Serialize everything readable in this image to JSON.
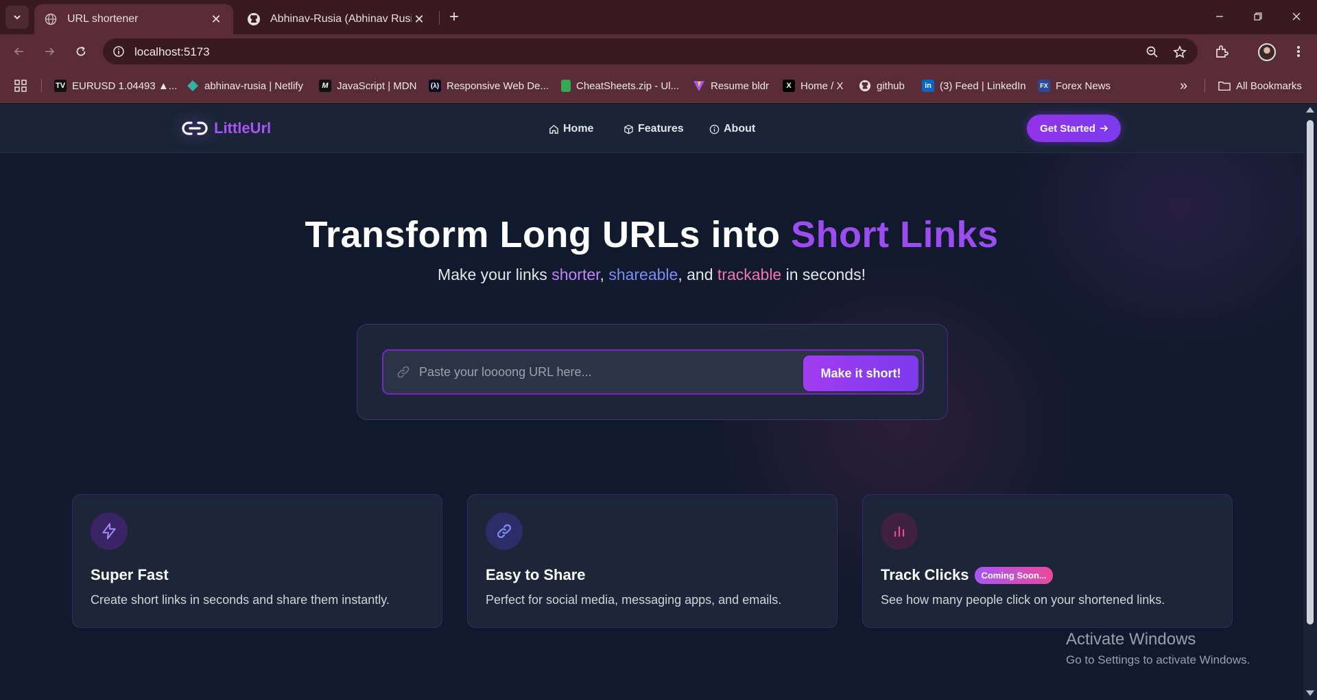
{
  "browser": {
    "tabs": [
      {
        "title": "URL shortener",
        "active": true,
        "icon": "globe-icon"
      },
      {
        "title": "Abhinav-Rusia (Abhinav Rusia)",
        "active": false,
        "icon": "github-icon"
      }
    ],
    "address": "localhost:5173",
    "bookmarks": [
      {
        "label": "EURUSD 1.04493 ▲...",
        "icon": "tradingview-icon"
      },
      {
        "label": "abhinav-rusia | Netlify",
        "icon": "netlify-icon"
      },
      {
        "label": "JavaScript | MDN",
        "icon": "mdn-icon"
      },
      {
        "label": "Responsive Web De...",
        "icon": "freecodecamp-icon"
      },
      {
        "label": "CheatSheets.zip - Ul...",
        "icon": "cheatsheets-icon"
      },
      {
        "label": "Resume bldr",
        "icon": "vite-icon"
      },
      {
        "label": "Home / X",
        "icon": "x-icon"
      },
      {
        "label": "github",
        "icon": "github-icon"
      },
      {
        "label": "(3) Feed | LinkedIn",
        "icon": "linkedin-icon"
      },
      {
        "label": "Forex News",
        "icon": "forex-icon"
      }
    ],
    "all_bookmarks": "All Bookmarks"
  },
  "site": {
    "brand": "LittleUrl",
    "nav": [
      {
        "label": "Home",
        "icon": "home-icon"
      },
      {
        "label": "Features",
        "icon": "box-icon"
      },
      {
        "label": "About",
        "icon": "info-icon"
      }
    ],
    "cta": "Get Started",
    "cta_arrow": "→"
  },
  "hero": {
    "title_main": "Transform Long URLs into ",
    "title_accent": "Short Links",
    "sub_1": "Make your links ",
    "sub_shorter": "shorter",
    "sub_2": ", ",
    "sub_shareable": "shareable",
    "sub_3": ", and ",
    "sub_trackable": "trackable",
    "sub_4": " in seconds!"
  },
  "shortener": {
    "placeholder": "Paste your loooong URL here...",
    "value": "",
    "button": "Make it short!"
  },
  "features": [
    {
      "title": "Super Fast",
      "desc": "Create short links in seconds and share them instantly.",
      "icon": "lightning-icon"
    },
    {
      "title": "Easy to Share",
      "desc": "Perfect for social media, messaging apps, and emails.",
      "icon": "link-icon"
    },
    {
      "title": "Track Clicks",
      "desc": "See how many people click on your shortened links.",
      "icon": "bar-chart-icon",
      "badge": "Coming Soon..."
    }
  ],
  "watermark": {
    "line1": "Activate Windows",
    "line2": "Go to Settings to activate Windows."
  },
  "colors": {
    "accent": "#a855f7",
    "background": "#111a2c",
    "chrome": "#5a2c37"
  }
}
